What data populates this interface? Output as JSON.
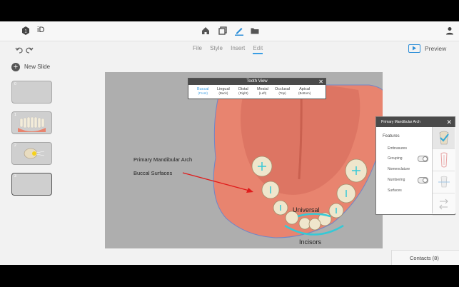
{
  "app": {
    "name": "iD"
  },
  "menu": [
    "File",
    "Style",
    "Insert",
    "Edit"
  ],
  "menu_active": "Edit",
  "preview_label": "Preview",
  "new_slide_label": "New Slide",
  "slides": [
    {
      "num": "0"
    },
    {
      "num": "1"
    },
    {
      "num": "2"
    },
    {
      "num": "3"
    }
  ],
  "canvas": {
    "label_arch": "Primary Mandibular Arch",
    "label_buccal": "Buccal Surfaces",
    "label_universal": "Universal",
    "label_incisors": "Incisors"
  },
  "tooth_view": {
    "title": "Tooth View",
    "options": [
      {
        "name": "Buccal",
        "sub": "(Front)",
        "active": true
      },
      {
        "name": "Lingual",
        "sub": "(Back)",
        "active": false
      },
      {
        "name": "Distal",
        "sub": "(Right)",
        "active": false
      },
      {
        "name": "Mesial",
        "sub": "(Left)",
        "active": false
      },
      {
        "name": "Occlusal",
        "sub": "(Top)",
        "active": false
      },
      {
        "name": "Apical",
        "sub": "(Bottom)",
        "active": false
      }
    ]
  },
  "features_panel": {
    "title": "Primary Mandibular Arch",
    "features_label": "Features",
    "items": [
      "Embrasures",
      "Grouping",
      "Nomenclature",
      "Numbering",
      "Surfaces"
    ]
  },
  "contacts_label": "Contacts (8)",
  "colors": {
    "accent": "#3a9ee4",
    "gum": "#e8846f",
    "highlight": "#35c9d6",
    "arrow": "#e01b1b"
  }
}
